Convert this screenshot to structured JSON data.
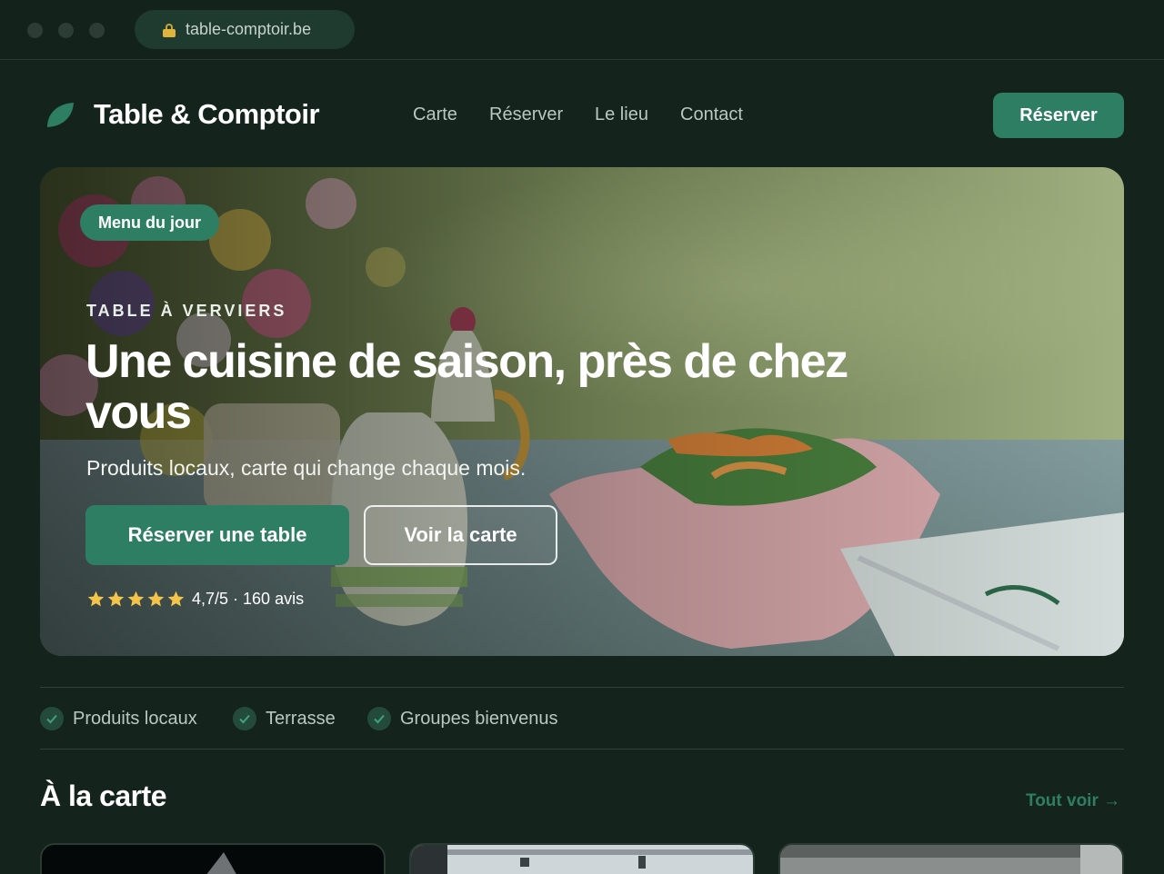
{
  "browser": {
    "url": "table-comptoir.be"
  },
  "nav": {
    "brand": "Table & Comptoir",
    "links": [
      "Carte",
      "Réserver",
      "Le lieu",
      "Contact"
    ],
    "cta": "Réserver"
  },
  "hero": {
    "badge": "Menu du jour",
    "eyebrow": "TABLE À VERVIERS",
    "headline": "Une cuisine de saison, près de chez vous",
    "subtitle": "Produits locaux, carte qui change chaque mois.",
    "primary_button": "Réserver une table",
    "secondary_button": "Voir la carte",
    "rating": {
      "stars": 5,
      "text": "4,7/5 · 160 avis"
    }
  },
  "features": [
    "Produits locaux",
    "Terrasse",
    "Groupes bienvenus"
  ],
  "menu_section": {
    "title": "À la carte",
    "see_all": "Tout voir →"
  },
  "colors": {
    "background": "#14241d",
    "accent": "#2e7e64",
    "star": "#f4c44a"
  }
}
